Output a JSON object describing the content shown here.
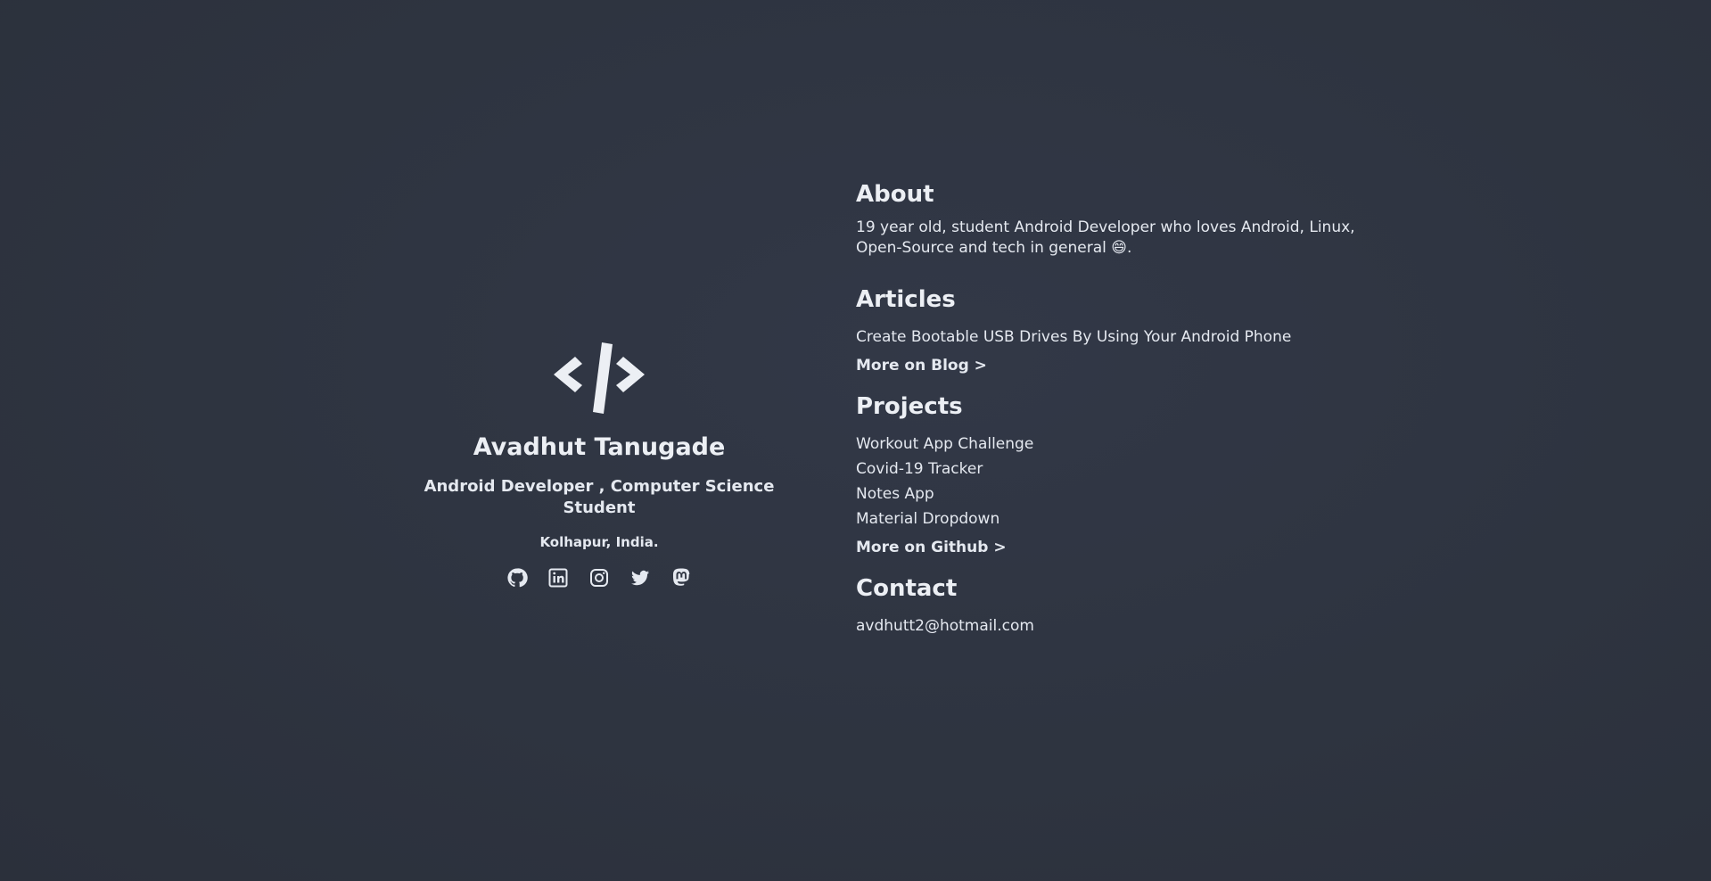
{
  "profile": {
    "name": "Avadhut Tanugade",
    "role": "Android Developer , Computer Science Student",
    "location": "Kolhapur, India.",
    "logo_icon": "code-brackets-icon",
    "socials": [
      {
        "icon": "github-icon"
      },
      {
        "icon": "linkedin-icon"
      },
      {
        "icon": "instagram-icon"
      },
      {
        "icon": "twitter-icon"
      },
      {
        "icon": "mastodon-icon"
      }
    ]
  },
  "about": {
    "title": "About",
    "text": "19 year old, student Android Developer who loves Android, Linux, Open-Source and tech in general 😄."
  },
  "articles": {
    "title": "Articles",
    "items": [
      "Create Bootable USB Drives By Using Your Android Phone"
    ],
    "more": "More on Blog >"
  },
  "projects": {
    "title": "Projects",
    "items": [
      "Workout App Challenge",
      "Covid-19 Tracker",
      "Notes App",
      "Material Dropdown"
    ],
    "more": "More on Github >"
  },
  "contact": {
    "title": "Contact",
    "email": "avdhutt2@hotmail.com"
  },
  "colors": {
    "background": "#2e3440",
    "text": "#eceff4"
  }
}
